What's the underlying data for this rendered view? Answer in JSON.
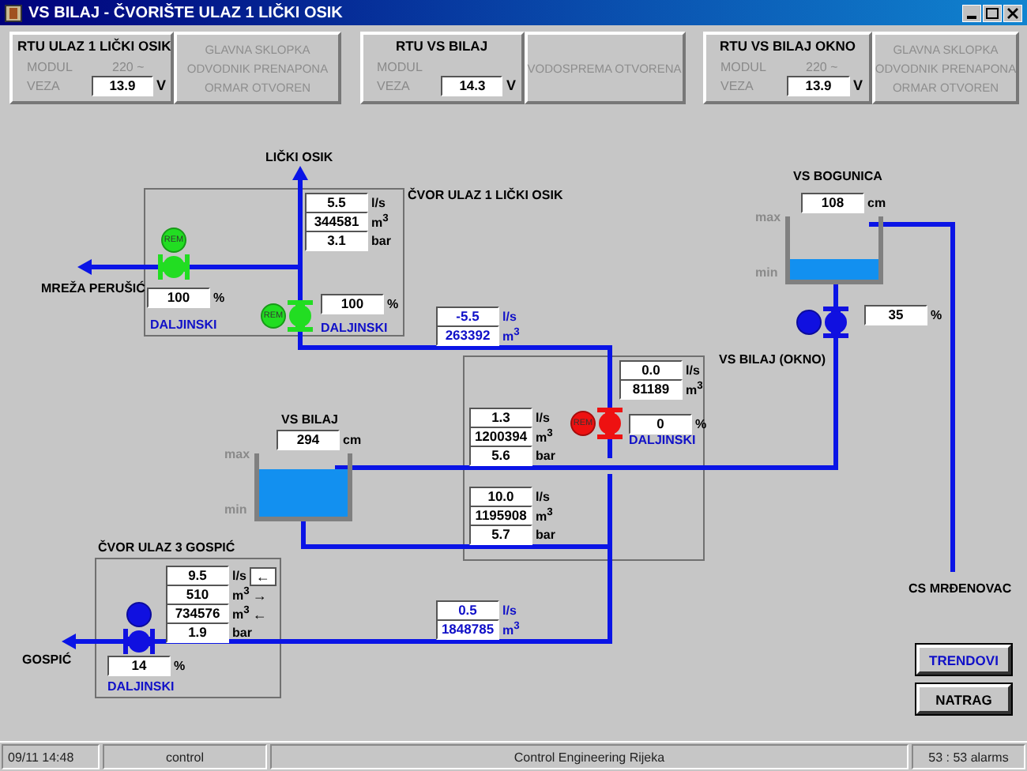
{
  "window": {
    "title": "VS BILAJ - ČVORIŠTE ULAZ 1 LIČKI OSIK"
  },
  "rtu_panels": [
    {
      "title": "RTU ULAZ 1 LIČKI OSIK",
      "rows": [
        {
          "label": "MODUL",
          "text": "220 ~"
        },
        {
          "label": "VEZA",
          "value": "13.9",
          "unit": "V"
        }
      ],
      "alarms": [
        {
          "label": "GLAVNA SKLOPKA",
          "active": false
        },
        {
          "label": "ODVODNIK PRENAPONA",
          "active": false
        },
        {
          "label": "ORMAR OTVOREN",
          "active": false
        }
      ]
    },
    {
      "title": "RTU VS BILAJ",
      "rows": [
        {
          "label": "MODUL"
        },
        {
          "label": "VEZA",
          "value": "14.3",
          "unit": "V"
        }
      ],
      "alarms": [
        {
          "label": "VODOSPREMA OTVORENA",
          "active": false
        }
      ]
    },
    {
      "title": "RTU VS BILAJ OKNO",
      "rows": [
        {
          "label": "MODUL",
          "text": "220 ~"
        },
        {
          "label": "VEZA",
          "value": "13.9",
          "unit": "V"
        }
      ],
      "alarms": [
        {
          "label": "GLAVNA SKLOPKA",
          "active": false
        },
        {
          "label": "ODVODNIK PRENAPONA",
          "active": false
        },
        {
          "label": "ORMAR OTVOREN",
          "active": false
        }
      ]
    }
  ],
  "diagram": {
    "labels": [
      {
        "text": "LIČKI OSIK",
        "kind": "name"
      },
      {
        "text": "ČVOR ULAZ 1 LIČKI OSIK",
        "kind": "name"
      },
      {
        "text": "VS BOGUNICA",
        "kind": "name"
      },
      {
        "text": "MREŽA PERUŠIĆ",
        "kind": "name"
      },
      {
        "text": "DALJINSKI",
        "kind": "mode"
      },
      {
        "text": "DALJINSKI",
        "kind": "mode"
      },
      {
        "text": "VS BILAJ (OKNO)",
        "kind": "name"
      },
      {
        "text": "DALJINSKI",
        "kind": "mode"
      },
      {
        "text": "VS BILAJ",
        "kind": "name"
      },
      {
        "text": "ČVOR ULAZ 3 GOSPIĆ",
        "kind": "name"
      },
      {
        "text": "CS MRĐENOVAC",
        "kind": "name"
      },
      {
        "text": "GOSPIĆ",
        "kind": "name"
      },
      {
        "text": "DALJINSKI",
        "kind": "mode"
      }
    ],
    "readouts": [
      {
        "value": "5.5",
        "unit": "l/s",
        "highlight": false
      },
      {
        "value": "344581",
        "unit": "m$^{3}$",
        "highlight": false
      },
      {
        "value": "3.1",
        "unit": "bar",
        "highlight": false
      },
      {
        "value": "100",
        "unit": "%",
        "highlight": false
      },
      {
        "value": "100",
        "unit": "%",
        "highlight": false
      },
      {
        "value": "-5.5",
        "unit": "l/s",
        "highlight": true
      },
      {
        "value": "263392",
        "unit": "m$^{3}$",
        "highlight": true
      },
      {
        "value": "108",
        "unit": "cm",
        "highlight": false
      },
      {
        "value": "35",
        "unit": "%",
        "highlight": false
      },
      {
        "value": "0.0",
        "unit": "l/s",
        "highlight": false
      },
      {
        "value": "81189",
        "unit": "m$^{3}$",
        "highlight": false
      },
      {
        "value": "1.3",
        "unit": "l/s",
        "highlight": false
      },
      {
        "value": "1200394",
        "unit": "m$^{3}$",
        "highlight": false
      },
      {
        "value": "5.6",
        "unit": "bar",
        "highlight": false
      },
      {
        "value": "0",
        "unit": "%",
        "highlight": false
      },
      {
        "value": "294",
        "unit": "cm",
        "highlight": false
      },
      {
        "value": "10.0",
        "unit": "l/s",
        "highlight": false
      },
      {
        "value": "1195908",
        "unit": "m$^{3}$",
        "highlight": false
      },
      {
        "value": "5.7",
        "unit": "bar",
        "highlight": false
      },
      {
        "value": "9.5",
        "unit": "l/s",
        "highlight": false,
        "arrow": "←",
        "arrow_boxed": true
      },
      {
        "value": "510",
        "unit": "m$^{3}$",
        "highlight": false,
        "arrow": "→",
        "arrow_boxed": false
      },
      {
        "value": "734576",
        "unit": "m$^{3}$",
        "highlight": false,
        "arrow": "←",
        "arrow_boxed": false
      },
      {
        "value": "1.9",
        "unit": "bar",
        "highlight": false
      },
      {
        "value": "14",
        "unit": "%",
        "highlight": false
      },
      {
        "value": "0.5",
        "unit": "l/s",
        "highlight": true
      },
      {
        "value": "1848785",
        "unit": "m$^{3}$",
        "highlight": true
      }
    ],
    "valves": [
      {
        "color": "#22dd22",
        "label": "REM"
      },
      {
        "color": "#22dd22",
        "label": "REM"
      },
      {
        "color": "#ee1111",
        "label": "REM"
      },
      {
        "color": "#1010e0"
      },
      {
        "color": "#1010e0"
      }
    ],
    "tanks": [
      {
        "max_label": "max",
        "min_label": "min"
      },
      {
        "max_label": "max",
        "min_label": "min"
      }
    ]
  },
  "buttons": [
    {
      "label": "TRENDOVI",
      "highlight": true
    },
    {
      "label": "NATRAG",
      "highlight": false
    }
  ],
  "status_bar": [
    "09/11 14:48",
    "control",
    "Control Engineering Rijeka",
    "53 : 53 alarms"
  ]
}
